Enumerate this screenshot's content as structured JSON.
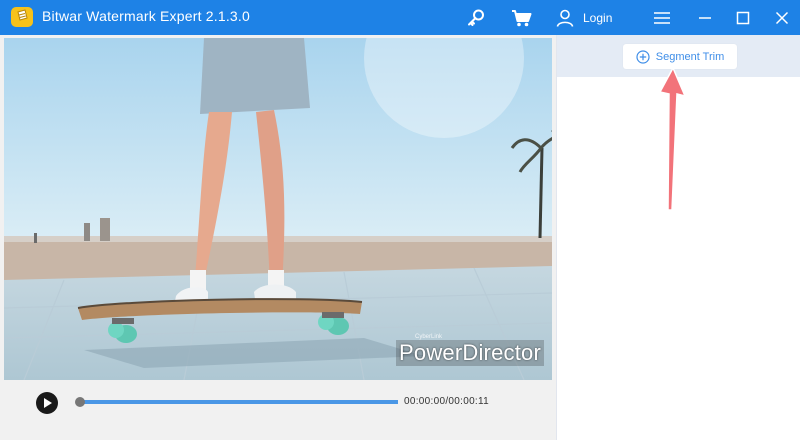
{
  "app": {
    "title": "Bitwar Watermark Expert  2.1.3.0",
    "login_label": "Login"
  },
  "toolbar": {
    "icons": [
      "key-icon",
      "cart-icon",
      "user-icon",
      "menu-icon",
      "minimize-icon",
      "maximize-icon",
      "close-icon"
    ]
  },
  "preview": {
    "watermark_text": "PowerDirector",
    "watermark_small": "CyberLink"
  },
  "player": {
    "time": "00:00:00/00:00:11",
    "progress": 0.0
  },
  "right_panel": {
    "segment_trim_label": "Segment Trim"
  },
  "colors": {
    "titlebar": "#1e82e6",
    "accent": "#3f8ee8",
    "arrow": "#f2737a",
    "panel_header": "#e4ebf5"
  }
}
